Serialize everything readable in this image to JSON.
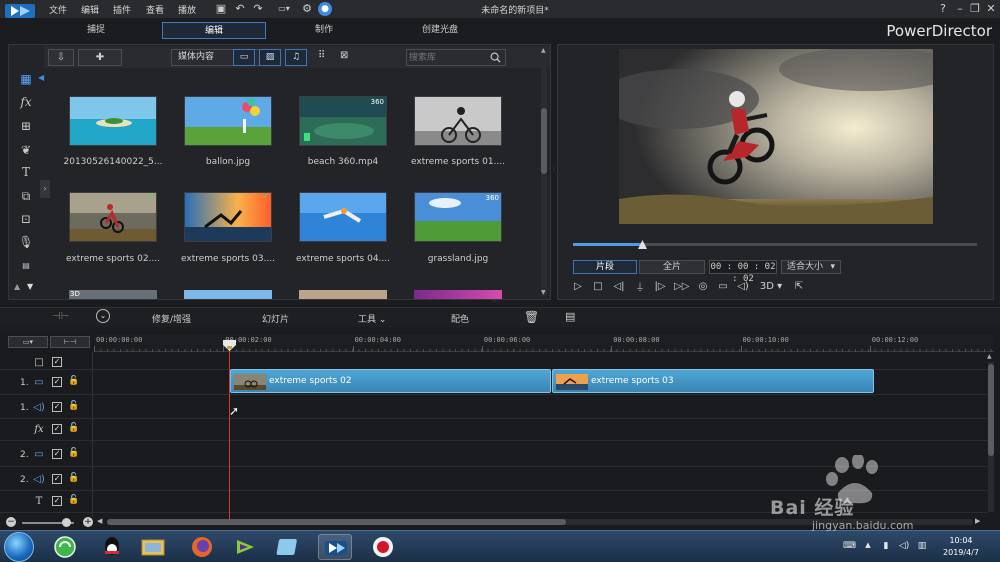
{
  "menu": {
    "items": [
      "文件",
      "编辑",
      "插件",
      "查看",
      "播放"
    ]
  },
  "title": "未命名的新项目*",
  "brand": "PowerDirector",
  "mode_tabs": [
    "捕捉",
    "编辑",
    "制作",
    "创建光盘"
  ],
  "library": {
    "dropdown": "媒体内容",
    "search_placeholder": "搜索库",
    "items": [
      {
        "label": "20130526140022_5...",
        "badge": "",
        "checked": false
      },
      {
        "label": "ballon.jpg",
        "badge": "",
        "checked": false
      },
      {
        "label": "beach 360.mp4",
        "badge": "360",
        "checked": false
      },
      {
        "label": "extreme sports 01....",
        "badge": "",
        "checked": false
      },
      {
        "label": "extreme sports 02....",
        "badge": "",
        "checked": true
      },
      {
        "label": "extreme sports 03....",
        "badge": "",
        "checked": true
      },
      {
        "label": "extreme sports 04....",
        "badge": "",
        "checked": false
      },
      {
        "label": "grassland.jpg",
        "badge": "360",
        "checked": false
      }
    ],
    "partial_badge": "3D"
  },
  "preview": {
    "clip_button": "片段",
    "full_button": "全片",
    "timecode": "00 : 00 : 02 : 02",
    "fit_select": "适合大小",
    "mode_3d": "3D",
    "progress": 0.17
  },
  "timeline_toolbar": {
    "repair": "修复/增强",
    "slideshow": "幻灯片",
    "tools": "工具",
    "color": "配色"
  },
  "ruler": [
    "00:00:00:00",
    "00:00:02:00",
    "00:00:04:00",
    "00:00:06:00",
    "00:00:08:00",
    "00:00:10:00",
    "00:00:12:00"
  ],
  "tracks": [
    {
      "num": "",
      "type": "master"
    },
    {
      "num": "1.",
      "type": "video"
    },
    {
      "num": "1.",
      "type": "audio"
    },
    {
      "num": "",
      "type": "fx",
      "label": "fx"
    },
    {
      "num": "2.",
      "type": "video"
    },
    {
      "num": "2.",
      "type": "audio"
    },
    {
      "num": "",
      "type": "title",
      "label": "T"
    }
  ],
  "clips": [
    {
      "label": "extreme sports 02"
    },
    {
      "label": "extreme sports 03"
    }
  ],
  "taskbar": {
    "time": "10:04",
    "date": "2019/4/7"
  },
  "watermark": {
    "text": "Bai 经验",
    "url": "jingyan.baidu.com"
  }
}
